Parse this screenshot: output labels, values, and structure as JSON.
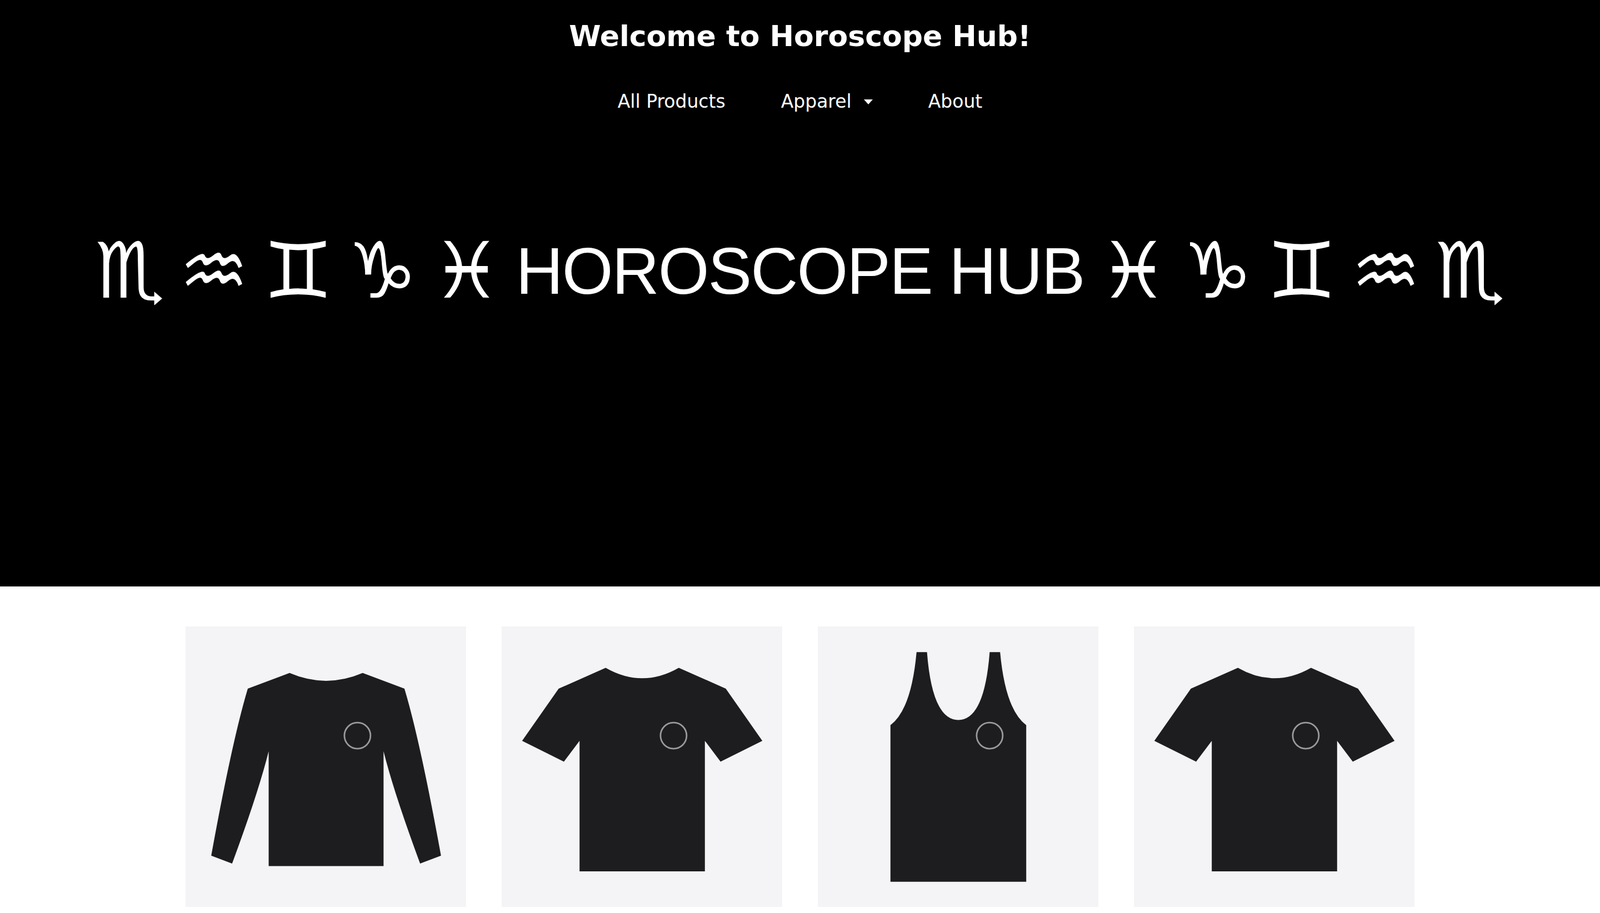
{
  "header": {
    "title": "Welcome to Horoscope Hub!"
  },
  "nav": [
    {
      "label": "All Products",
      "kind": "link"
    },
    {
      "label": "Apparel",
      "kind": "dropdown"
    },
    {
      "label": "About",
      "kind": "link"
    }
  ],
  "banner": {
    "left_signs": [
      "♏",
      "♒",
      "♊",
      "♑",
      "♓"
    ],
    "text": "HOROSCOPE HUB",
    "right_signs": [
      "♓",
      "♑",
      "♊",
      "♒",
      "♏"
    ]
  },
  "products": [
    {
      "kind": "longsleeve"
    },
    {
      "kind": "tee"
    },
    {
      "kind": "tank"
    },
    {
      "kind": "tee"
    }
  ]
}
